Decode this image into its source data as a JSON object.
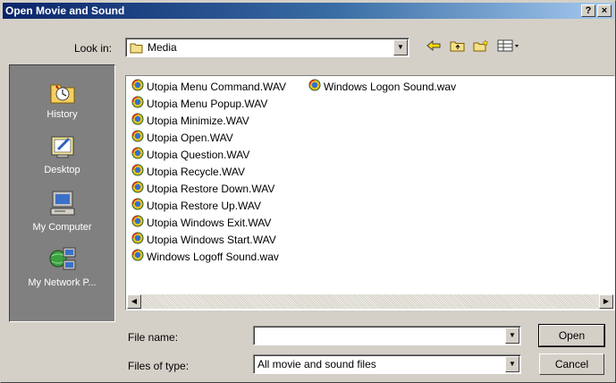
{
  "window": {
    "title": "Open Movie and Sound",
    "help_label": "?",
    "close_label": "×"
  },
  "lookin": {
    "label": "Look in:",
    "value": "Media",
    "icons": [
      "back-arrow-icon",
      "up-folder-icon",
      "new-folder-icon",
      "view-menu-icon"
    ]
  },
  "places": [
    {
      "label": "History",
      "icon": "history-icon"
    },
    {
      "label": "Desktop",
      "icon": "desktop-icon"
    },
    {
      "label": "My Computer",
      "icon": "my-computer-icon"
    },
    {
      "label": "My Network P...",
      "icon": "network-places-icon"
    }
  ],
  "files": {
    "column1": [
      "Utopia Menu Command.WAV",
      "Utopia Menu Popup.WAV",
      "Utopia Minimize.WAV",
      "Utopia Open.WAV",
      "Utopia Question.WAV",
      "Utopia Recycle.WAV",
      "Utopia Restore Down.WAV",
      "Utopia Restore Up.WAV",
      "Utopia Windows Exit.WAV",
      "Utopia Windows Start.WAV",
      "Windows Logoff Sound.wav"
    ],
    "column2": [
      "Windows Logon Sound.wav"
    ]
  },
  "filename": {
    "label": "File name:",
    "value": ""
  },
  "filetype": {
    "label": "Files of type:",
    "value": "All movie and sound files"
  },
  "buttons": {
    "open": "Open",
    "cancel": "Cancel"
  }
}
